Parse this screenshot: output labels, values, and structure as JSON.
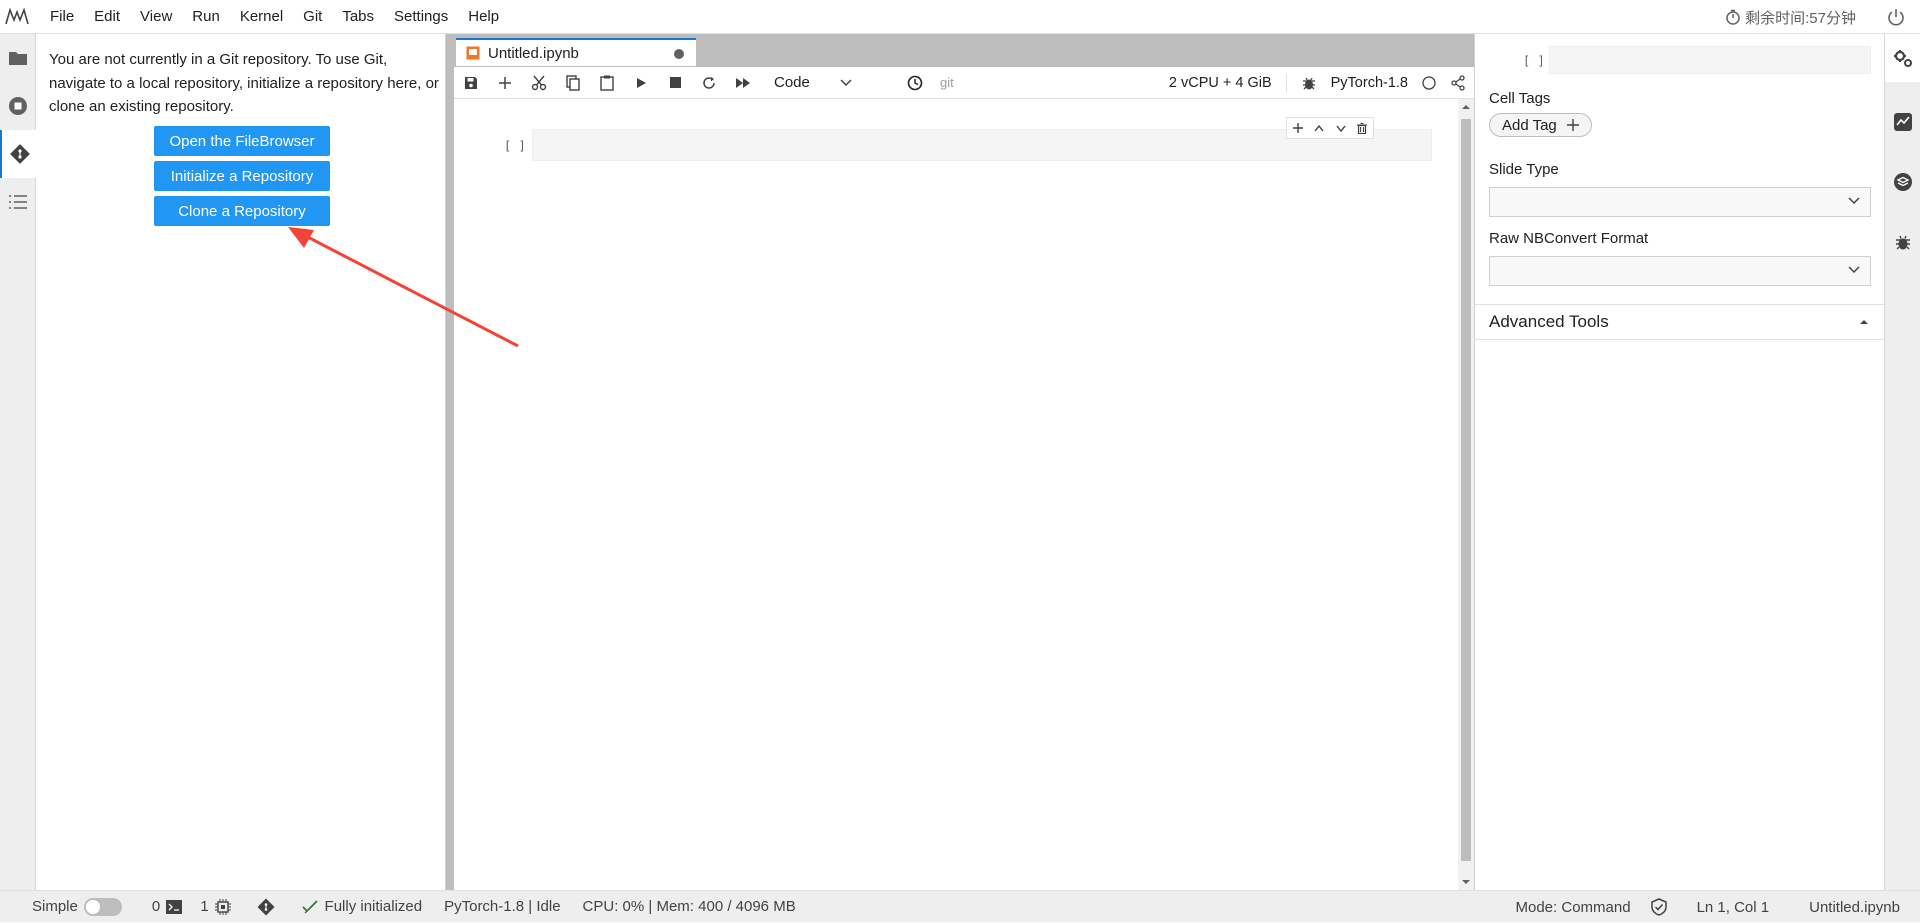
{
  "menu": {
    "items": [
      "File",
      "Edit",
      "View",
      "Run",
      "Kernel",
      "Git",
      "Tabs",
      "Settings",
      "Help"
    ],
    "timer_text": "剩余时间:57分钟"
  },
  "git_panel": {
    "message": "You are not currently in a Git repository. To use Git, navigate to a local repository, initialize a repository here, or clone an existing repository.",
    "buttons": {
      "open_filebrowser": "Open the FileBrowser",
      "initialize": "Initialize a Repository",
      "clone": "Clone a Repository"
    },
    "annotation_color": "#f44336"
  },
  "notebook": {
    "tab_title": "Untitled.ipynb",
    "cell_type": "Code",
    "git_label": "git",
    "resources": "2 vCPU + 4 GiB",
    "kernel_name": "PyTorch-1.8",
    "cell_prompt": "[ ]"
  },
  "inspector": {
    "prompt": "[ ]",
    "cell_tags_label": "Cell Tags",
    "add_tag_label": "Add Tag",
    "slide_type_label": "Slide Type",
    "raw_format_label": "Raw NBConvert Format",
    "advanced_tools_label": "Advanced Tools"
  },
  "status": {
    "mode_simple": "Simple",
    "terminals_count": "0",
    "kernels_count": "1",
    "git_status": "Fully initialized",
    "kernel_status": "PyTorch-1.8 | Idle",
    "resource_usage": "CPU: 0% | Mem: 400 / 4096 MB",
    "mode": "Mode: Command",
    "cursor": "Ln 1, Col 1",
    "file": "Untitled.ipynb"
  },
  "colors": {
    "accent": "#2196f3",
    "tab_border": "#1976d2",
    "arrow": "#f44336"
  }
}
